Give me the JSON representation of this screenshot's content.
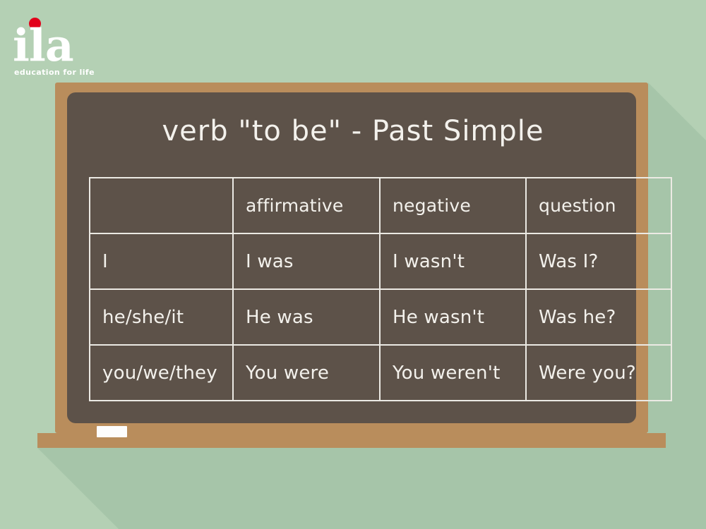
{
  "logo": {
    "word": "ila",
    "tagline": "education for life",
    "dot_color": "#e2001a",
    "dot_icon": "red-dot-icon"
  },
  "board": {
    "title": "verb \"to be\" - Past Simple",
    "frame_color": "#b98d5c",
    "surface_color": "#5d5249",
    "chalk_color": "#f3f1ec",
    "chalk_piece_label": "chalk"
  },
  "background": {
    "color": "#b4d0b4",
    "shadow_color": "#a6c5a9"
  },
  "table": {
    "headers": [
      "",
      "affirmative",
      "negative",
      "question"
    ],
    "rows": [
      {
        "subject": "I",
        "affirmative": "I was",
        "negative": "I wasn't",
        "question": "Was I?"
      },
      {
        "subject": "he/she/it",
        "affirmative": "He was",
        "negative": "He wasn't",
        "question": "Was he?"
      },
      {
        "subject": "you/we/they",
        "affirmative": "You were",
        "negative": "You weren't",
        "question": "Were you?"
      }
    ]
  }
}
